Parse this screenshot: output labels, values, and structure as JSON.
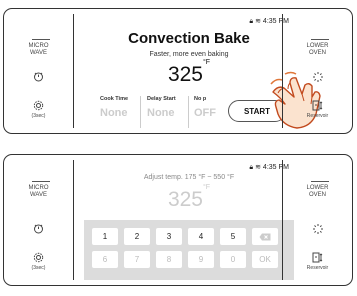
{
  "left_panel": {
    "microwave_label_1": "MICRO",
    "microwave_label_2": "WAVE",
    "timer_icon": "timer-icon",
    "settings_icon": "gear-icon",
    "settings_sub": "(3sec)"
  },
  "right_panel": {
    "lower_oven_label_1": "LOWER",
    "lower_oven_label_2": "OVEN",
    "light_icon": "light-icon",
    "reservoir_icon": "reservoir-icon",
    "reservoir_label": "Reservoir"
  },
  "status": {
    "time": "4:35 PM",
    "icons": [
      "lock-icon",
      "wifi-icon"
    ]
  },
  "top_screen": {
    "title": "Convection Bake",
    "subtitle": "Faster, more even baking",
    "temperature": "325",
    "unit": "°F",
    "options": [
      {
        "label": "Cook Time",
        "value": "None"
      },
      {
        "label": "Delay Start",
        "value": "None"
      },
      {
        "label": "No p",
        "value": "OFF"
      }
    ],
    "start_label": "START"
  },
  "bottom_screen": {
    "adjust_text": "Adjust temp. 175 °F ~ 550 °F",
    "temperature": "325",
    "unit": "°F",
    "keys_row1": [
      "1",
      "2",
      "3",
      "4",
      "5"
    ],
    "keys_row2": [
      "6",
      "7",
      "8",
      "9",
      "0"
    ],
    "backspace_icon": "backspace-icon",
    "ok_label": "OK"
  },
  "colors": {
    "border": "#333333",
    "keypad_bg": "#dcdcdc",
    "dim_text": "#cccccc"
  }
}
